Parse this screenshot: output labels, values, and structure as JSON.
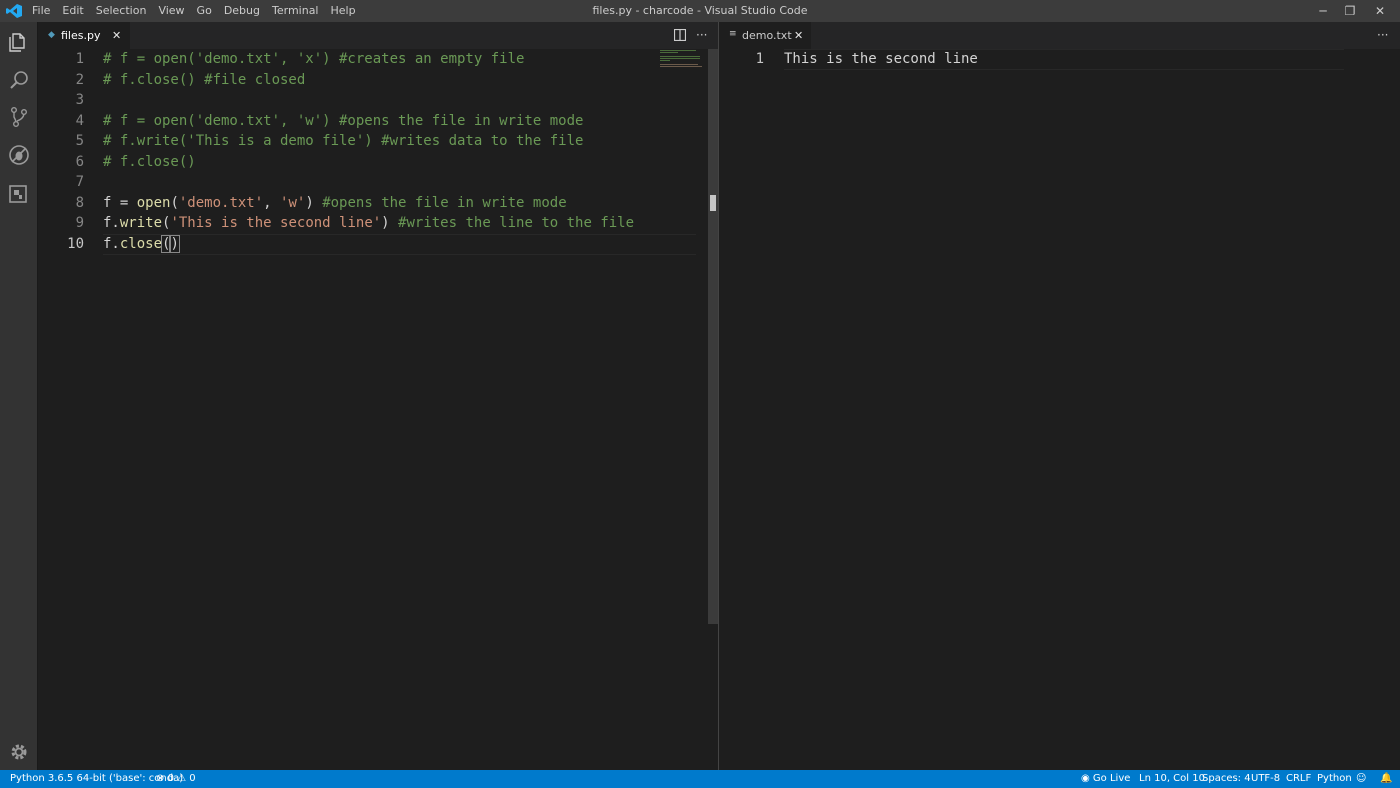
{
  "window": {
    "title": "files.py - charcode - Visual Studio Code",
    "controls": {
      "minimize": "─",
      "restore": "❐",
      "close": "✕"
    }
  },
  "menu": [
    "File",
    "Edit",
    "Selection",
    "View",
    "Go",
    "Debug",
    "Terminal",
    "Help"
  ],
  "activity_bar": {
    "icons": [
      "explorer-icon",
      "search-icon",
      "source-control-icon",
      "debug-icon",
      "extensions-icon"
    ],
    "bottom_icon": "gear-icon"
  },
  "editor_left": {
    "tab": {
      "icon": "◆",
      "label": "files.py",
      "close": "✕"
    },
    "more": "···",
    "lines": [
      {
        "n": "1",
        "tokens": [
          {
            "t": "# f = open('demo.txt', 'x') #creates an empty file",
            "c": "cm"
          }
        ]
      },
      {
        "n": "2",
        "tokens": [
          {
            "t": "# f.close() #file closed",
            "c": "cm"
          }
        ]
      },
      {
        "n": "3",
        "tokens": []
      },
      {
        "n": "4",
        "tokens": [
          {
            "t": "# f = open('demo.txt', 'w') #opens the file in write mode",
            "c": "cm"
          }
        ]
      },
      {
        "n": "5",
        "tokens": [
          {
            "t": "# f.write('This is a demo file') #writes data to the file",
            "c": "cm"
          }
        ]
      },
      {
        "n": "6",
        "tokens": [
          {
            "t": "# f.close()",
            "c": "cm"
          }
        ]
      },
      {
        "n": "7",
        "tokens": []
      },
      {
        "n": "8",
        "tokens": [
          {
            "t": "f = ",
            "c": ""
          },
          {
            "t": "open",
            "c": "fn"
          },
          {
            "t": "(",
            "c": ""
          },
          {
            "t": "'demo.txt'",
            "c": "str"
          },
          {
            "t": ", ",
            "c": ""
          },
          {
            "t": "'w'",
            "c": "str"
          },
          {
            "t": ") ",
            "c": ""
          },
          {
            "t": "#opens the file in write mode",
            "c": "cm"
          }
        ]
      },
      {
        "n": "9",
        "tokens": [
          {
            "t": "f.",
            "c": ""
          },
          {
            "t": "write",
            "c": "fn"
          },
          {
            "t": "(",
            "c": ""
          },
          {
            "t": "'This is the second line'",
            "c": "str"
          },
          {
            "t": ") ",
            "c": ""
          },
          {
            "t": "#writes the line to the file",
            "c": "cm"
          }
        ]
      },
      {
        "n": "10",
        "tokens": [
          {
            "t": "f.",
            "c": ""
          },
          {
            "t": "close",
            "c": "fn"
          },
          {
            "t": "(",
            "c": "br"
          },
          {
            "t": ")",
            "c": "br"
          }
        ]
      }
    ],
    "active_line": 10
  },
  "editor_right": {
    "tab": {
      "icon": "≡",
      "label": "demo.txt",
      "close": "✕"
    },
    "more": "···",
    "lines": [
      {
        "n": "1",
        "text": "This is the second line"
      }
    ]
  },
  "status_bar": {
    "interpreter": "Python 3.6.5 64-bit ('base': conda)",
    "errors": "0",
    "warnings": "0",
    "go_live": "Go Live",
    "position": "Ln 10, Col 10",
    "spaces": "Spaces: 4",
    "encoding": "UTF-8",
    "eol": "CRLF",
    "language": "Python"
  },
  "colors": {
    "accent": "#007acc",
    "comment": "#6a9955",
    "string": "#ce9178",
    "function": "#dcdcaa"
  }
}
